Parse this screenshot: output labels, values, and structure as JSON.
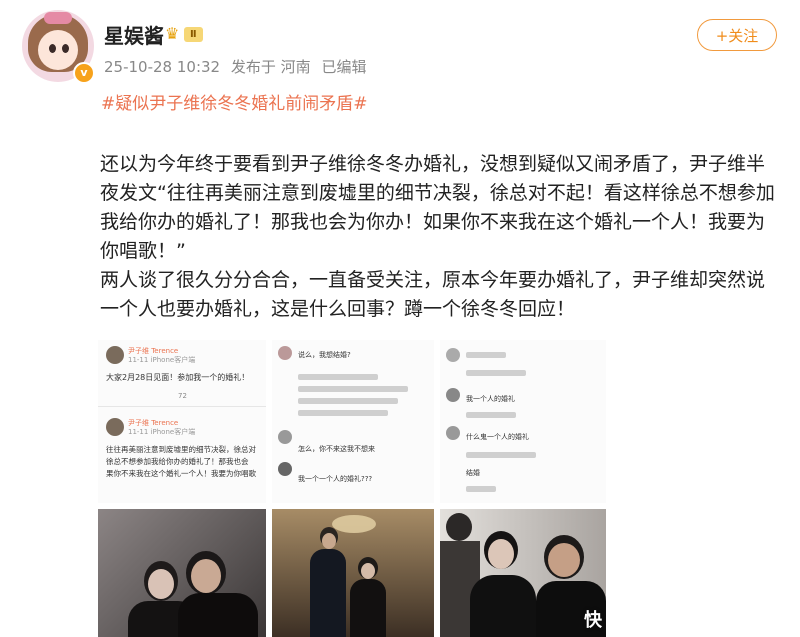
{
  "post": {
    "username": "星娱酱",
    "level_badge": "Ⅱ",
    "verified_icon": "v-badge-icon",
    "crown_icon": "crown-icon",
    "timestamp": "25-10-28 10:32",
    "location": "发布于 河南",
    "edited": "已编辑",
    "follow_label": "+关注",
    "topic": "#疑似尹子维徐冬冬婚礼前闹矛盾#",
    "paragraphs": [
      "还以为今年终于要看到尹子维徐冬冬办婚礼，没想到疑似又闹矛盾了，尹子维半夜发文“往往再美丽注意到废墟里的细节决裂，徐总对不起！看这样徐总不想参加我给你办的婚礼了！那我也会为你办！如果你不来我在这个婚礼一个人！我要为你唱歌！”",
      "两人谈了很久分分合合，一直备受关注，原本今年要办婚礼了，尹子维却突然说一个人也要办婚礼，这是什么回事？蹲一个徐冬冬回应！"
    ]
  },
  "screenshot1": {
    "name1": "尹子维 Terence",
    "sub1": "11-11 iPhone客户端",
    "text1": "大家2月28日见面！参加我一个的婚礼！",
    "count1": "72",
    "name2": "尹子维 Terence",
    "sub2": "11-11 iPhone客户端",
    "lines2": [
      "往往再美丽注意到废墟里的细节决裂，徐总对",
      "徐总不想参加我给你办的婚礼了！那我也会",
      "果你不来我在这个婚礼一个人！我要为你唱歌"
    ]
  },
  "screenshot2": {
    "lines": [
      "说么，我想结婚?",
      "怎么，你不来这我不想来",
      "我一个一个人的婚礼???"
    ]
  },
  "screenshot3": {
    "lines": [
      "我一个人的婚礼",
      "什么鬼一个人的婚礼",
      "结婚"
    ]
  },
  "watermark": "快",
  "colors": {
    "accent_orange": "#f08c1b",
    "topic_red": "#eb7350",
    "meta_gray": "#888888"
  }
}
